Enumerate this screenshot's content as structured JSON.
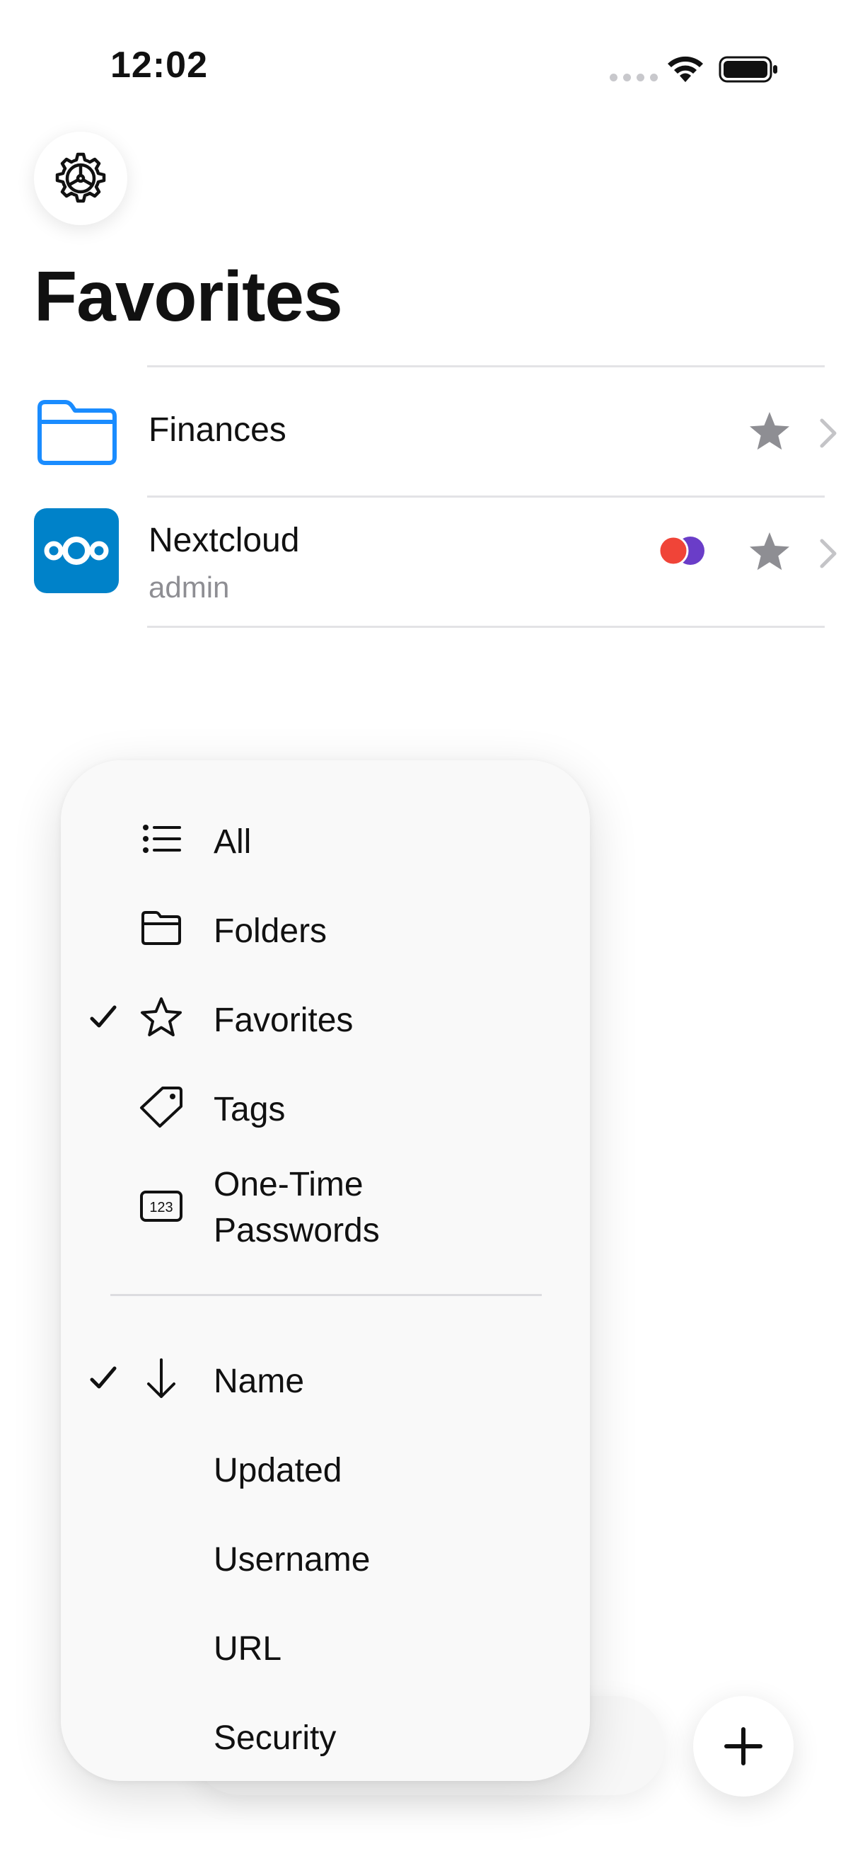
{
  "status_bar": {
    "time": "12:02"
  },
  "header": {
    "title": "Favorites"
  },
  "items": [
    {
      "title": "Finances",
      "subtitle": ""
    },
    {
      "title": "Nextcloud",
      "subtitle": "admin"
    }
  ],
  "menu": {
    "filters": [
      {
        "label": "All",
        "icon": "list-icon",
        "checked": false
      },
      {
        "label": "Folders",
        "icon": "folder-icon",
        "checked": false
      },
      {
        "label": "Favorites",
        "icon": "star-icon",
        "checked": true
      },
      {
        "label": "Tags",
        "icon": "tag-icon",
        "checked": false
      },
      {
        "label": "One-Time Passwords",
        "icon": "otp-icon",
        "checked": false
      }
    ],
    "sort": [
      {
        "label": "Name",
        "icon": "arrow-down-icon",
        "checked": true
      },
      {
        "label": "Updated",
        "checked": false
      },
      {
        "label": "Username",
        "checked": false
      },
      {
        "label": "URL",
        "checked": false
      },
      {
        "label": "Security",
        "checked": false
      }
    ]
  },
  "colors": {
    "accent": "#1a8cff",
    "nextcloud": "#0082c9",
    "badge_red": "#f04438",
    "badge_purple": "#6a3dc8",
    "star_gray": "#8e8e93"
  }
}
